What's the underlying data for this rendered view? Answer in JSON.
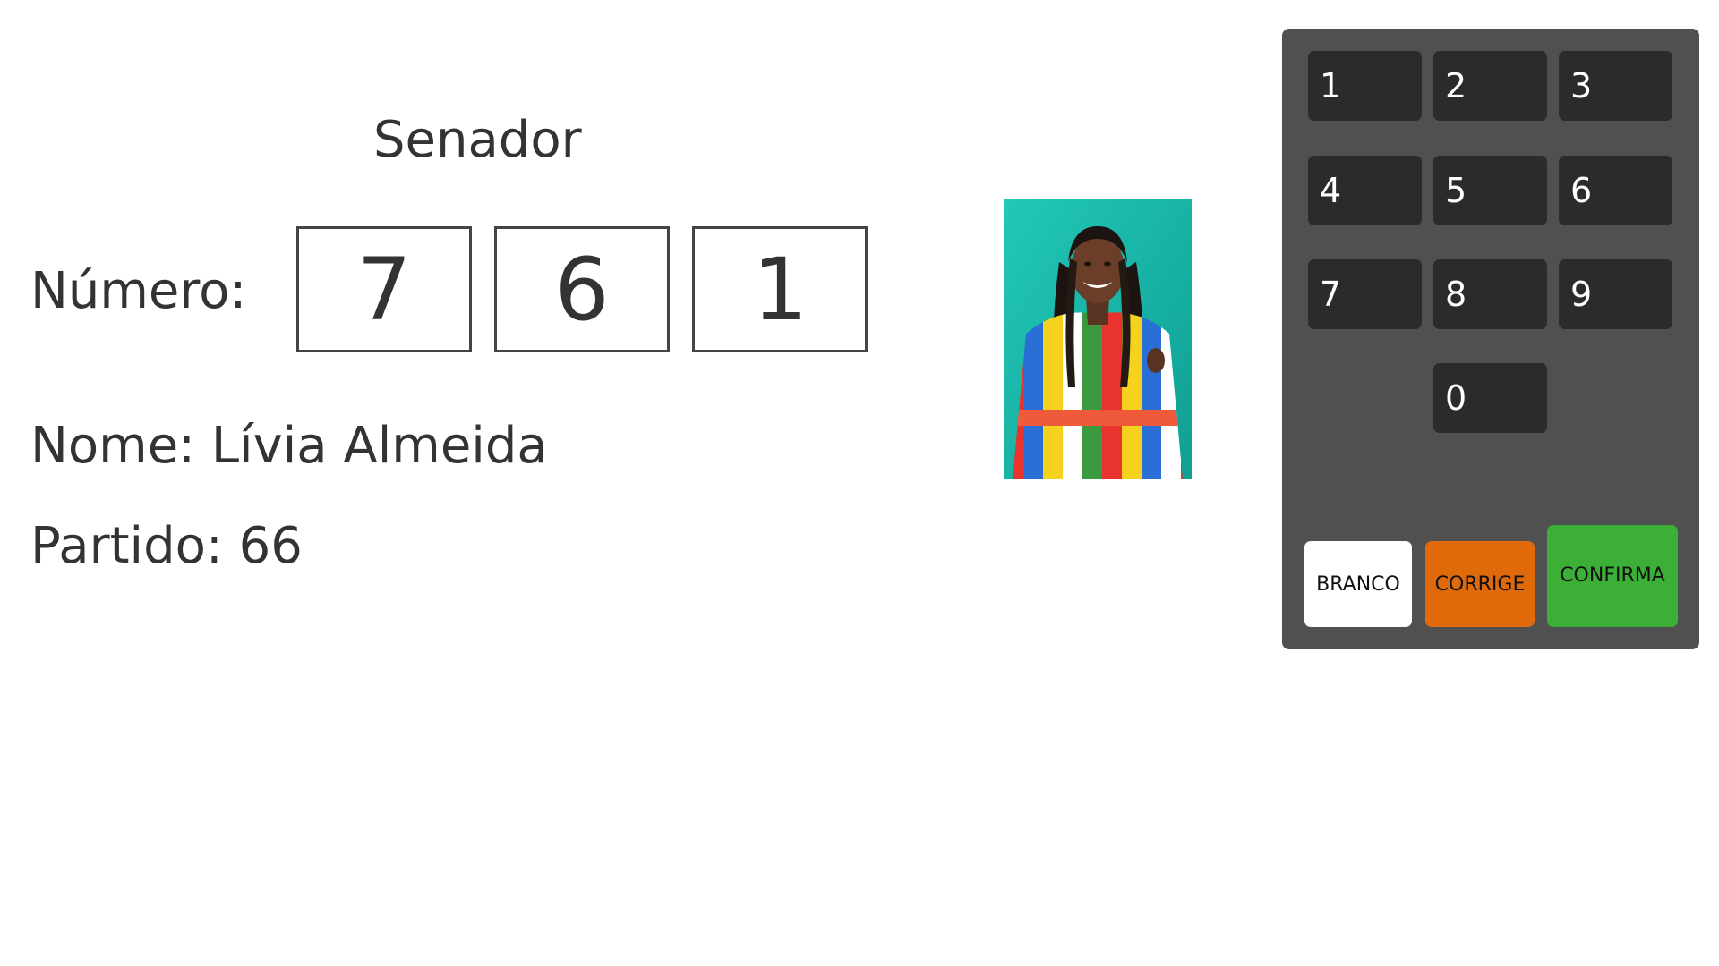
{
  "ballot": {
    "office_title": "Senador",
    "numero_label": "Número:",
    "digits": [
      "7",
      "6",
      "1"
    ],
    "nome_line": "Nome: Lívia Almeida",
    "partido_line": "Partido: 66"
  },
  "keypad": {
    "keys": [
      "1",
      "2",
      "3",
      "4",
      "5",
      "6",
      "7",
      "8",
      "9",
      "0"
    ],
    "branco_label": "BRANCO",
    "corrige_label": "CORRIGE",
    "confirma_label": "CONFIRMA"
  },
  "colors": {
    "keypad_bg": "#505050",
    "key_bg": "#2b2b2b",
    "branco": "#ffffff",
    "corrige": "#e06a0a",
    "confirma": "#3caf36",
    "photo_bg": "#13a89c"
  }
}
